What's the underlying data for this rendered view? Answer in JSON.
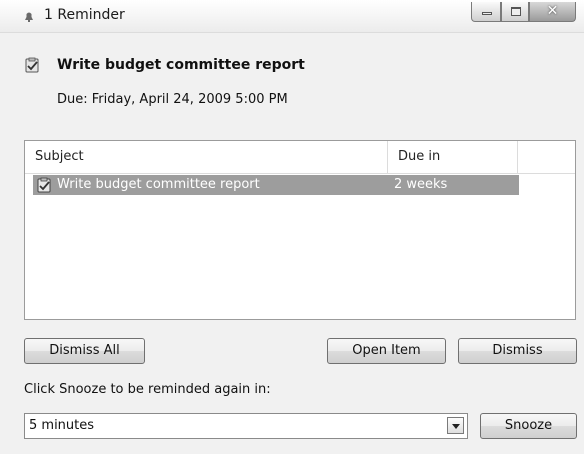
{
  "window": {
    "title": "1 Reminder",
    "title_icon": "reminder-bell-icon"
  },
  "header": {
    "icon": "task-clipboard-icon",
    "subject": "Write budget committee report",
    "due": "Due: Friday, April 24, 2009 5:00 PM"
  },
  "list": {
    "columns": [
      "Subject",
      "Due in"
    ],
    "rows": [
      {
        "icon": "task-clipboard-icon",
        "subject": "Write budget committee report",
        "due_in": "2 weeks",
        "selected": true
      }
    ]
  },
  "buttons": {
    "dismiss_all": "Dismiss All",
    "open_item": "Open Item",
    "dismiss": "Dismiss",
    "snooze": "Snooze"
  },
  "snooze": {
    "label": "Click Snooze to be reminded again in:",
    "selected": "5 minutes"
  },
  "colors": {
    "selection": "#9d9d9d",
    "window_bg": "#f1f1f1"
  }
}
